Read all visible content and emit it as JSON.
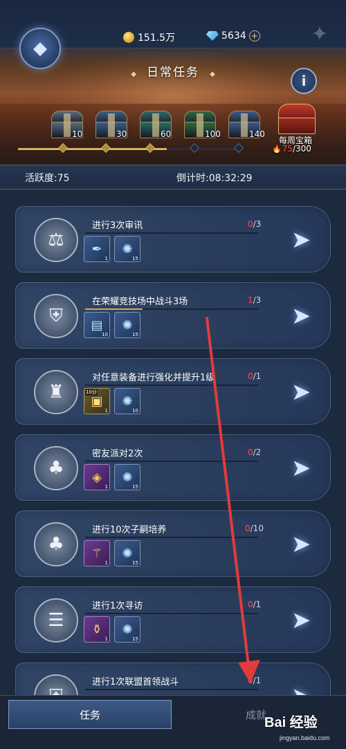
{
  "header": {
    "currency": {
      "coins": "151.5万",
      "gems": "5634"
    },
    "title": "日常任务",
    "info_icon": "info-icon",
    "chests": [
      {
        "label": "10",
        "color": "#5b6b7e"
      },
      {
        "label": "30",
        "color": "#3a5e8c"
      },
      {
        "label": "60",
        "color": "#2c6b6a"
      },
      {
        "label": "100",
        "color": "#2e6a3e"
      },
      {
        "label": "140",
        "color": "#3f5a8f"
      }
    ],
    "weekly": {
      "label": "每周宝箱",
      "current": "75",
      "total": "/300"
    },
    "activity_progress": 75,
    "activity_max": 140
  },
  "stats": {
    "activity": "活跃度:75",
    "countdown": "倒计时:08:32:29"
  },
  "tasks": [
    {
      "name": "进行3次审讯",
      "progress_current": "0",
      "progress_total": "/3",
      "fraction": 0,
      "icon": "scales-icon",
      "rewards": [
        {
          "icon": "quill-icon",
          "qty": "1",
          "style": "blue"
        },
        {
          "icon": "crystal-icon",
          "qty": "15",
          "style": "blue"
        }
      ]
    },
    {
      "name": "在荣耀竞技场中战斗3场",
      "progress_current": "1",
      "progress_total": "/3",
      "fraction": 0.333,
      "icon": "shield-swords-icon",
      "rewards": [
        {
          "icon": "book-icon",
          "qty": "10",
          "style": "blue"
        },
        {
          "icon": "crystal-icon",
          "qty": "15",
          "style": "blue"
        }
      ]
    },
    {
      "name": "对任意装备进行强化并提升1级",
      "progress_current": "0",
      "progress_total": "/1",
      "fraction": 0,
      "icon": "helmet-icon",
      "rewards": [
        {
          "icon": "chest-icon",
          "qty": "1",
          "style": "gold",
          "tag": "10分"
        },
        {
          "icon": "crystal-icon",
          "qty": "10",
          "style": "blue"
        }
      ]
    },
    {
      "name": "密友派对2次",
      "progress_current": "0",
      "progress_total": "/2",
      "fraction": 0,
      "icon": "family-tree-icon",
      "rewards": [
        {
          "icon": "gift-box-icon",
          "qty": "1",
          "style": "purple"
        },
        {
          "icon": "crystal-icon",
          "qty": "15",
          "style": "blue"
        }
      ]
    },
    {
      "name": "进行10次子嗣培养",
      "progress_current": "0",
      "progress_total": "/10",
      "fraction": 0,
      "icon": "family-tree-icon",
      "rewards": [
        {
          "icon": "staff-icon",
          "qty": "1",
          "style": "purple"
        },
        {
          "icon": "crystal-icon",
          "qty": "15",
          "style": "blue"
        }
      ]
    },
    {
      "name": "进行1次寻访",
      "progress_current": "0",
      "progress_total": "/1",
      "fraction": 0,
      "icon": "scroll-icon",
      "rewards": [
        {
          "icon": "potion-icon",
          "qty": "1",
          "style": "purple"
        },
        {
          "icon": "crystal-icon",
          "qty": "15",
          "style": "blue"
        }
      ]
    },
    {
      "name": "进行1次联盟首领战斗",
      "progress_current": "0",
      "progress_total": "/1",
      "fraction": 0,
      "icon": "shield-swords-icon",
      "rewards": []
    }
  ],
  "tabs": {
    "active": "任务",
    "inactive": "成就"
  },
  "watermark": {
    "brand": "Bai 经验",
    "url": "jingyan.baidu.com"
  },
  "colors": {
    "accent_gold": "#d6a84e",
    "progress_red": "#ff4a4a",
    "annotation_red": "#e23b3b"
  }
}
